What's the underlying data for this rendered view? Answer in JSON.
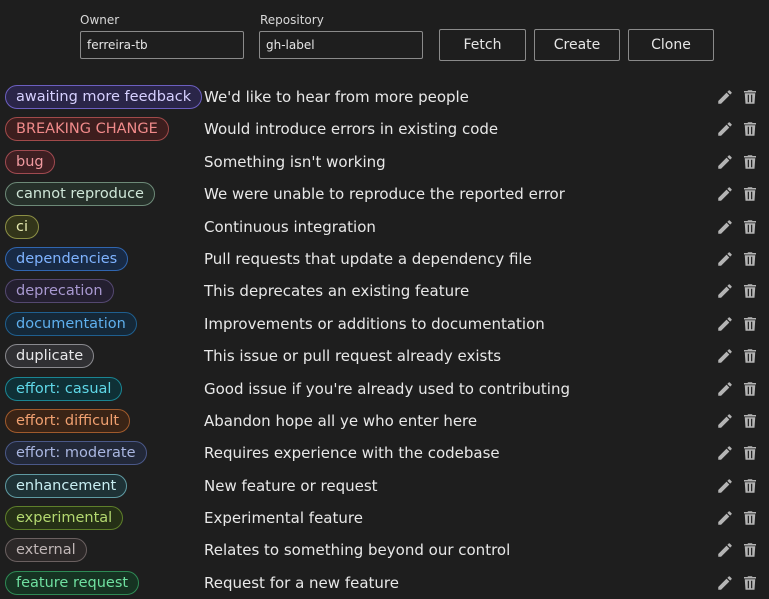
{
  "form": {
    "owner_label": "Owner",
    "owner_value": "ferreira-tb",
    "repo_label": "Repository",
    "repo_value": "gh-label",
    "fetch_label": "Fetch",
    "create_label": "Create",
    "clone_label": "Clone"
  },
  "icons": {
    "edit": "pencil-icon",
    "delete": "trash-icon"
  },
  "labels": [
    {
      "name": "awaiting more feedback",
      "description": "We'd like to hear from more people",
      "bg": "#2a2548",
      "border": "#6c5fc0",
      "fg": "#d6d0ff"
    },
    {
      "name": "BREAKING CHANGE",
      "description": "Would introduce errors in existing code",
      "bg": "#3d1e1e",
      "border": "#a14a4a",
      "fg": "#f08a8a"
    },
    {
      "name": "bug",
      "description": "Something isn't working",
      "bg": "#3d1f22",
      "border": "#a04a50",
      "fg": "#f09aa0"
    },
    {
      "name": "cannot reproduce",
      "description": "We were unable to reproduce the reported error",
      "bg": "#26302a",
      "border": "#6d8a78",
      "fg": "#cfe6d8"
    },
    {
      "name": "ci",
      "description": "Continuous integration",
      "bg": "#33351a",
      "border": "#8c8f45",
      "fg": "#e7eab0"
    },
    {
      "name": "dependencies",
      "description": "Pull requests that update a dependency file",
      "bg": "#182a45",
      "border": "#3066b0",
      "fg": "#7fb3ff"
    },
    {
      "name": "deprecation",
      "description": "This deprecates an existing feature",
      "bg": "#241f30",
      "border": "#544870",
      "fg": "#a898d0"
    },
    {
      "name": "documentation",
      "description": "Improvements or additions to documentation",
      "bg": "#152838",
      "border": "#1f5f8f",
      "fg": "#5fb0ee"
    },
    {
      "name": "duplicate",
      "description": "This issue or pull request already exists",
      "bg": "#303033",
      "border": "#8a8a8f",
      "fg": "#e8e8ea"
    },
    {
      "name": "effort: casual",
      "description": "Good issue if you're already used to contributing",
      "bg": "#0f3036",
      "border": "#1a8593",
      "fg": "#5fd8e8"
    },
    {
      "name": "effort: difficult",
      "description": "Abandon hope all ye who enter here",
      "bg": "#3a2416",
      "border": "#a05a2c",
      "fg": "#f0a070"
    },
    {
      "name": "effort: moderate",
      "description": "Requires experience with the codebase",
      "bg": "#222838",
      "border": "#4a5888",
      "fg": "#a9b6e0"
    },
    {
      "name": "enhancement",
      "description": "New feature or request",
      "bg": "#1e3236",
      "border": "#5f9aa2",
      "fg": "#c8eef2"
    },
    {
      "name": "experimental",
      "description": "Experimental feature",
      "bg": "#253016",
      "border": "#5e7f2a",
      "fg": "#b3d870"
    },
    {
      "name": "external",
      "description": "Relates to something beyond our control",
      "bg": "#2c2828",
      "border": "#6a6060",
      "fg": "#c0b6b6"
    },
    {
      "name": "feature request",
      "description": "Request for a new feature",
      "bg": "#163322",
      "border": "#2e8a55",
      "fg": "#6fe0a0"
    }
  ]
}
